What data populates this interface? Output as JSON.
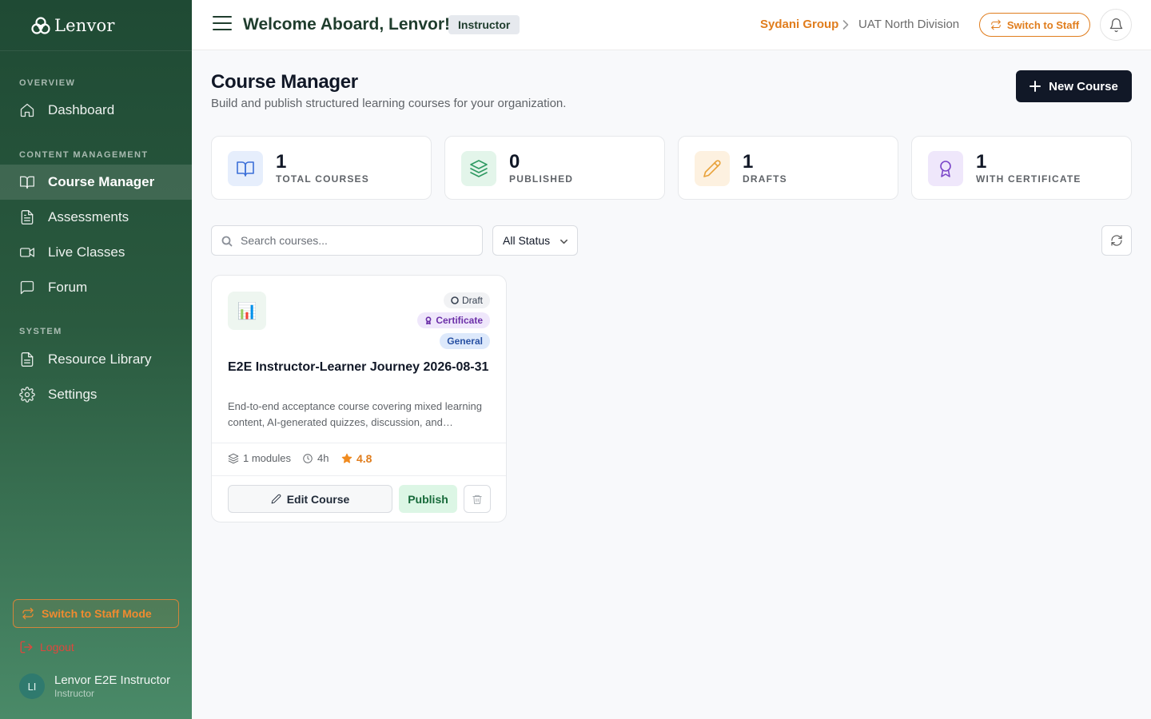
{
  "app": {
    "name": "Lenvor"
  },
  "sidebar": {
    "sections": {
      "overview": "OVERVIEW",
      "content": "CONTENT MANAGEMENT",
      "system": "SYSTEM"
    },
    "items": [
      {
        "label": "Dashboard",
        "icon": "home-icon",
        "active": false
      },
      {
        "label": "Course Manager",
        "icon": "book-open-icon",
        "active": true
      },
      {
        "label": "Assessments",
        "icon": "document-icon",
        "active": false
      },
      {
        "label": "Live Classes",
        "icon": "video-icon",
        "active": false
      },
      {
        "label": "Forum",
        "icon": "chat-bubble-icon",
        "active": false
      },
      {
        "label": "Resource Library",
        "icon": "file-icon",
        "active": false
      },
      {
        "label": "Settings",
        "icon": "gear-icon",
        "active": false
      }
    ],
    "switch_mode": "Switch to Staff Mode",
    "logout": "Logout",
    "user": {
      "initials": "LI",
      "name": "Lenvor E2E Instructor",
      "role": "Instructor"
    }
  },
  "header": {
    "welcome": "Welcome Aboard, Lenvor!",
    "role_badge": "Instructor",
    "breadcrumb": {
      "org": "Sydani Group",
      "division": "UAT North Division"
    },
    "switch_button": "Switch to Staff"
  },
  "page": {
    "title": "Course Manager",
    "subtitle": "Build and publish structured learning courses for your organization.",
    "new_course_button": "New Course"
  },
  "stats": [
    {
      "value": "1",
      "label": "TOTAL COURSES",
      "icon": "book-open-icon",
      "color": "#3b6fd8",
      "bg": "#e6eefc"
    },
    {
      "value": "0",
      "label": "PUBLISHED",
      "icon": "layers-icon",
      "color": "#2f9a62",
      "bg": "#e3f5ea"
    },
    {
      "value": "1",
      "label": "DRAFTS",
      "icon": "pencil-icon",
      "color": "#e8a23a",
      "bg": "#fdf1e0"
    },
    {
      "value": "1",
      "label": "WITH CERTIFICATE",
      "icon": "award-icon",
      "color": "#7a45c8",
      "bg": "#efe7fb"
    }
  ],
  "filters": {
    "search_placeholder": "Search courses...",
    "status_value": "All Status"
  },
  "courses": [
    {
      "thumb_icon": "📊",
      "badges": {
        "status": "Draft",
        "certificate": "Certificate",
        "category": "General"
      },
      "title": "E2E Instructor-Learner Journey 2026-08-31",
      "description": "End-to-end acceptance course covering mixed learning content, AI-generated quizzes, discussion, and certification.",
      "modules": "1 modules",
      "duration": "4h",
      "rating": "4.8",
      "edit_label": "Edit Course",
      "publish_label": "Publish"
    }
  ]
}
